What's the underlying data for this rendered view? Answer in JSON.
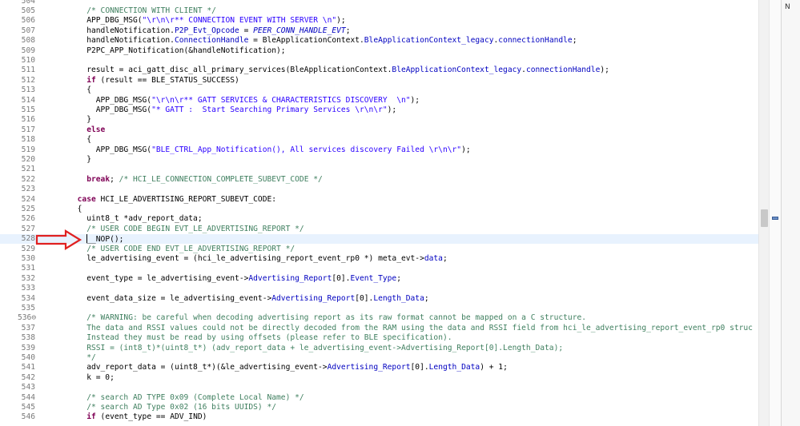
{
  "editor": {
    "lines": [
      {
        "n": "504",
        "segs": []
      },
      {
        "n": "505",
        "segs": [
          {
            "t": "        "
          },
          {
            "t": "/* CONNECTION WITH CLIENT */",
            "c": "cmt"
          }
        ]
      },
      {
        "n": "506",
        "segs": [
          {
            "t": "        APP_DBG_MSG("
          },
          {
            "t": "\"\\r\\n\\r** CONNECTION EVENT WITH SERVER \\n\"",
            "c": "str"
          },
          {
            "t": ");"
          }
        ]
      },
      {
        "n": "507",
        "segs": [
          {
            "t": "        handleNotification."
          },
          {
            "t": "P2P_Evt_Opcode",
            "c": "fld"
          },
          {
            "t": " = "
          },
          {
            "t": "PEER_CONN_HANDLE_EVT",
            "c": "macro-it"
          },
          {
            "t": ";"
          }
        ]
      },
      {
        "n": "508",
        "segs": [
          {
            "t": "        handleNotification."
          },
          {
            "t": "ConnectionHandle",
            "c": "fld"
          },
          {
            "t": " = BleApplicationContext."
          },
          {
            "t": "BleApplicationContext_legacy",
            "c": "fld"
          },
          {
            "t": "."
          },
          {
            "t": "connectionHandle",
            "c": "fld"
          },
          {
            "t": ";"
          }
        ]
      },
      {
        "n": "509",
        "segs": [
          {
            "t": "        P2PC_APP_Notification(&handleNotification);"
          }
        ]
      },
      {
        "n": "510",
        "segs": []
      },
      {
        "n": "511",
        "segs": [
          {
            "t": "        result = aci_gatt_disc_all_primary_services(BleApplicationContext."
          },
          {
            "t": "BleApplicationContext_legacy",
            "c": "fld"
          },
          {
            "t": "."
          },
          {
            "t": "connectionHandle",
            "c": "fld"
          },
          {
            "t": ");"
          }
        ]
      },
      {
        "n": "512",
        "segs": [
          {
            "t": "        "
          },
          {
            "t": "if",
            "c": "kw"
          },
          {
            "t": " (result == BLE_STATUS_SUCCESS)"
          }
        ]
      },
      {
        "n": "513",
        "segs": [
          {
            "t": "        {"
          }
        ]
      },
      {
        "n": "514",
        "segs": [
          {
            "t": "          APP_DBG_MSG("
          },
          {
            "t": "\"\\r\\n\\r** GATT SERVICES & CHARACTERISTICS DISCOVERY  \\n\"",
            "c": "str"
          },
          {
            "t": ");"
          }
        ]
      },
      {
        "n": "515",
        "segs": [
          {
            "t": "          APP_DBG_MSG("
          },
          {
            "t": "\"* GATT :  Start Searching Primary Services \\r\\n\\r\"",
            "c": "str"
          },
          {
            "t": ");"
          }
        ]
      },
      {
        "n": "516",
        "segs": [
          {
            "t": "        }"
          }
        ]
      },
      {
        "n": "517",
        "segs": [
          {
            "t": "        "
          },
          {
            "t": "else",
            "c": "kw"
          }
        ]
      },
      {
        "n": "518",
        "segs": [
          {
            "t": "        {"
          }
        ]
      },
      {
        "n": "519",
        "segs": [
          {
            "t": "          APP_DBG_MSG("
          },
          {
            "t": "\"BLE_CTRL_App_Notification(), All services discovery Failed \\r\\n\\r\"",
            "c": "str"
          },
          {
            "t": ");"
          }
        ]
      },
      {
        "n": "520",
        "segs": [
          {
            "t": "        }"
          }
        ]
      },
      {
        "n": "521",
        "segs": []
      },
      {
        "n": "522",
        "segs": [
          {
            "t": "        "
          },
          {
            "t": "break",
            "c": "kw"
          },
          {
            "t": "; "
          },
          {
            "t": "/* HCI_LE_CONNECTION_COMPLETE_SUBEVT_CODE */",
            "c": "cmt"
          }
        ]
      },
      {
        "n": "523",
        "segs": []
      },
      {
        "n": "524",
        "segs": [
          {
            "t": "      "
          },
          {
            "t": "case",
            "c": "kw"
          },
          {
            "t": " HCI_LE_ADVERTISING_REPORT_SUBEVT_CODE:"
          }
        ]
      },
      {
        "n": "525",
        "segs": [
          {
            "t": "      {"
          }
        ]
      },
      {
        "n": "526",
        "segs": [
          {
            "t": "        uint8_t *adv_report_data;"
          }
        ]
      },
      {
        "n": "527",
        "segs": [
          {
            "t": "        "
          },
          {
            "t": "/* USER CODE BEGIN EVT_LE_ADVERTISING_REPORT */",
            "c": "cmt"
          }
        ]
      },
      {
        "n": "528",
        "segs": [
          {
            "t": "        "
          },
          {
            "caret": true
          },
          {
            "t": "__NOP();"
          }
        ],
        "current": true
      },
      {
        "n": "529",
        "segs": [
          {
            "t": "        "
          },
          {
            "t": "/* USER CODE END EVT_LE_ADVERTISING_REPORT */",
            "c": "cmt"
          }
        ]
      },
      {
        "n": "530",
        "segs": [
          {
            "t": "        le_advertising_event = (hci_le_advertising_report_event_rp0 *) meta_evt->"
          },
          {
            "t": "data",
            "c": "fld"
          },
          {
            "t": ";"
          }
        ]
      },
      {
        "n": "531",
        "segs": []
      },
      {
        "n": "532",
        "segs": [
          {
            "t": "        event_type = le_advertising_event->"
          },
          {
            "t": "Advertising_Report",
            "c": "fld"
          },
          {
            "t": "[0]."
          },
          {
            "t": "Event_Type",
            "c": "fld"
          },
          {
            "t": ";"
          }
        ]
      },
      {
        "n": "533",
        "segs": []
      },
      {
        "n": "534",
        "segs": [
          {
            "t": "        event_data_size = le_advertising_event->"
          },
          {
            "t": "Advertising_Report",
            "c": "fld"
          },
          {
            "t": "[0]."
          },
          {
            "t": "Length_Data",
            "c": "fld"
          },
          {
            "t": ";"
          }
        ]
      },
      {
        "n": "535",
        "segs": []
      },
      {
        "n": "536⊖",
        "segs": [
          {
            "t": "        "
          },
          {
            "t": "/* WARNING: be careful when decoding advertising report as its raw format cannot be mapped on a C structure.",
            "c": "cmt"
          }
        ]
      },
      {
        "n": "537",
        "segs": [
          {
            "t": "        "
          },
          {
            "t": "The data and RSSI values could not be directly decoded from the RAM using the data and RSSI field from hci_le_advertising_report_event_rp0 struc",
            "c": "cmt"
          }
        ]
      },
      {
        "n": "538",
        "segs": [
          {
            "t": "        "
          },
          {
            "t": "Instead they must be read by using offsets (please refer to BLE specification).",
            "c": "cmt"
          }
        ]
      },
      {
        "n": "539",
        "segs": [
          {
            "t": "        "
          },
          {
            "t": "RSSI = (int8_t)*(uint8_t*) (adv_report_data + le_advertising_event->Advertising_Report[0].Length_Data);",
            "c": "cmt"
          }
        ]
      },
      {
        "n": "540",
        "segs": [
          {
            "t": "        "
          },
          {
            "t": "*/",
            "c": "cmt"
          }
        ]
      },
      {
        "n": "541",
        "segs": [
          {
            "t": "        adv_report_data = (uint8_t*)(&le_advertising_event->"
          },
          {
            "t": "Advertising_Report",
            "c": "fld"
          },
          {
            "t": "[0]."
          },
          {
            "t": "Length_Data",
            "c": "fld"
          },
          {
            "t": ") + 1;"
          }
        ]
      },
      {
        "n": "542",
        "segs": [
          {
            "t": "        k = 0;"
          }
        ]
      },
      {
        "n": "543",
        "segs": []
      },
      {
        "n": "544",
        "segs": [
          {
            "t": "        "
          },
          {
            "t": "/* search AD TYPE 0x09 (Complete Local Name) */",
            "c": "cmt"
          }
        ]
      },
      {
        "n": "545",
        "segs": [
          {
            "t": "        "
          },
          {
            "t": "/* search AD Type 0x02 (16 bits UUIDS) */",
            "c": "cmt"
          }
        ]
      },
      {
        "n": "546",
        "segs": [
          {
            "t": "        "
          },
          {
            "t": "if",
            "c": "kw"
          },
          {
            "t": " (event_type == ADV_IND)"
          }
        ]
      }
    ]
  },
  "side_panel": {
    "label": "N"
  },
  "colors": {
    "keyword": "#7f0055",
    "string": "#2a00ff",
    "comment": "#3f7f5f",
    "field": "#0000c0",
    "current_line": "#e8f2fe",
    "annotation_arrow": "#e02020"
  },
  "icons": [
    "red-arrow-annotation-icon",
    "breakpoint-wrench-icon",
    "fold-toggle-icon",
    "overview-ruler-marker-icon"
  ]
}
